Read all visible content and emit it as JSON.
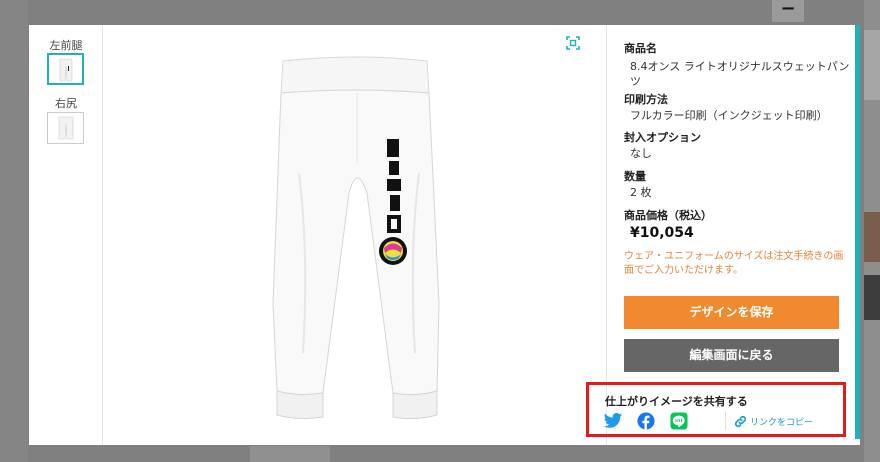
{
  "background": {
    "top_button_label": "−"
  },
  "thumbnails": [
    {
      "label": "左前腿",
      "active": true
    },
    {
      "label": "右尻",
      "active": false
    }
  ],
  "product": {
    "name_label": "商品名",
    "name_value": "8.4オンス ライトオリジナルスウェットパンツ",
    "print_label": "印刷方法",
    "print_value": "フルカラー印刷（インクジェット印刷）",
    "packing_label": "封入オプション",
    "packing_value": "なし",
    "qty_label": "数量",
    "qty_value": "2 枚",
    "price_label": "商品価格（税込）",
    "price_value": "¥10,054",
    "note": "ウェア・ユニフォームのサイズは注文手続きの画面でご入力いただけます。"
  },
  "buttons": {
    "save": "デザインを保存",
    "back": "編集画面に戻る"
  },
  "share": {
    "title": "仕上がりイメージを共有する",
    "copy_link": "リンクをコピー"
  },
  "colors": {
    "accent": "#1fb3b8",
    "save_button": "#f18a2e",
    "back_button": "#666666",
    "highlight": "#e11d1d",
    "twitter": "#1d9bf0",
    "facebook": "#1877f2",
    "line": "#06c755",
    "note": "#e8843a"
  },
  "icons": [
    "expand-icon",
    "twitter-icon",
    "facebook-icon",
    "line-icon",
    "link-icon"
  ]
}
